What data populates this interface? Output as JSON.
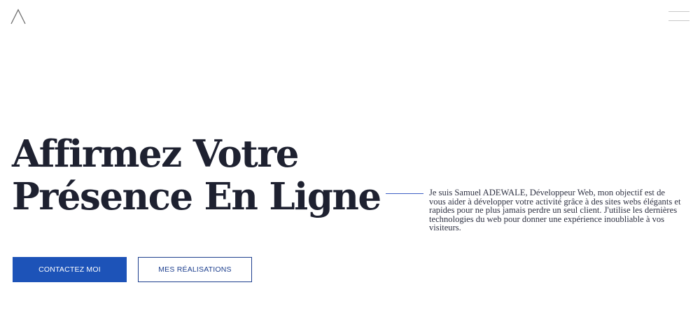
{
  "header": {
    "logo_icon": "chevron-up-logo",
    "menu_icon": "hamburger-menu-icon"
  },
  "hero": {
    "title_line1": "Affirmez Votre",
    "title_line2": "Présence En Ligne",
    "intro": "Je suis Samuel ADEWALE, Développeur Web, mon objectif est de vous aider à développer votre activité grâce à des sites webs élégants et rapides pour ne plus jamais perdre un seul client. J'utilise les dernières technologies du web pour donner une expérience inoubliable à vos visiteurs."
  },
  "actions": {
    "contact_label": "CONTACTEZ MOI",
    "portfolio_label": "MES RÉALISATIONS"
  },
  "colors": {
    "primary": "#1d53b8",
    "outline": "#1d3f8e",
    "title": "#1e2130",
    "accent_line": "#3d5fc4"
  }
}
